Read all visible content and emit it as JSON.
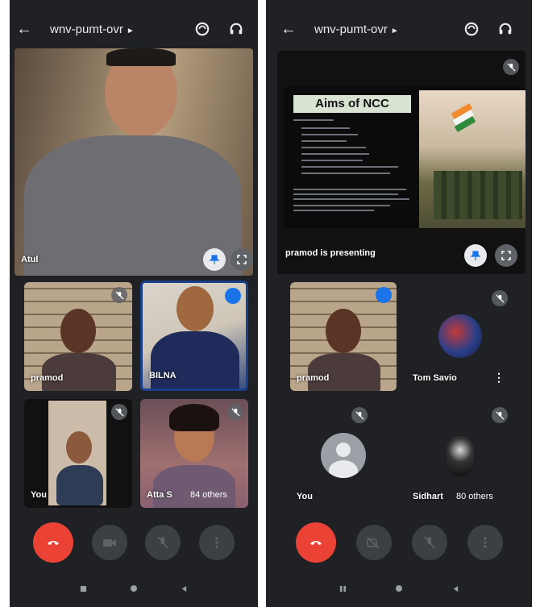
{
  "meeting": {
    "code": "wnv-pumt-ovr"
  },
  "left_phone": {
    "main_tile": {
      "name": "Atul"
    },
    "tiles": [
      {
        "name": "pramod"
      },
      {
        "name": "BILNA"
      },
      {
        "name": "You"
      },
      {
        "name": "Atta S",
        "others": "84 others"
      }
    ]
  },
  "right_phone": {
    "presentation": {
      "slide_title": "Aims of NCC",
      "presenting_text": "pramod is presenting"
    },
    "tiles": [
      {
        "name": "pramod"
      },
      {
        "name": "Tom Savio"
      },
      {
        "name": "You"
      },
      {
        "name": "Sidhart",
        "others": "80 others"
      }
    ]
  },
  "colors": {
    "end_call": "#ea4335",
    "background": "#202124",
    "active_blue": "#1a73e8"
  },
  "icons": [
    "back-arrow-icon",
    "chevron-right-icon",
    "switch-camera-icon",
    "headphones-icon",
    "pin-icon",
    "fullscreen-icon",
    "mic-off-icon",
    "end-call-icon",
    "camera-icon",
    "more-icon",
    "nav-recent-icon",
    "nav-home-icon",
    "nav-back-icon"
  ]
}
